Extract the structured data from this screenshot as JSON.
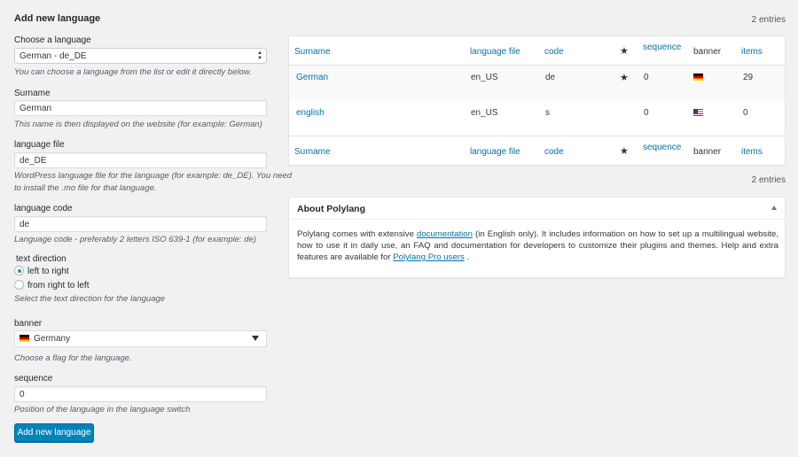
{
  "form": {
    "title": "Add new language",
    "choose_label": "Choose a language",
    "choose_value": "German - de_DE",
    "choose_desc": "You can choose a language from the list or edit it directly below.",
    "surname_label": "Surname",
    "surname_value": "German",
    "surname_desc": "This name is then displayed on the website (for example: German)",
    "langfile_label": "language file",
    "langfile_value": "de_DE",
    "langfile_desc_1": "WordPress language file for the language (for example: de_DE). You need",
    "langfile_desc_2": "to install the .mo file for that language.",
    "code_label": "language code",
    "code_value": "de",
    "code_desc": "Language code - preferably 2 letters ISO 639-1 (for example: de)",
    "direction_label": "text direction",
    "direction_ltr": "left to right",
    "direction_rtl": "from right to left",
    "direction_desc": "Select the text direction for the language",
    "banner_label": "banner",
    "banner_value": "Germany",
    "banner_desc": "Choose a flag for the language.",
    "sequence_label": "sequence",
    "sequence_value": "0",
    "sequence_desc": "Position of the language in the language switch",
    "submit_label": "Add new language"
  },
  "table": {
    "count_top": "2 entries",
    "count_bottom": "2 entries",
    "columns": {
      "surname": "Surname",
      "langfile": "language file",
      "code": "code",
      "default": "★",
      "sequence": "sequence",
      "banner": "banner",
      "items": "items"
    },
    "rows": [
      {
        "surname": "German",
        "langfile": "en_US",
        "code": "de",
        "default": "★",
        "sequence": "0",
        "flag": "germany-flag-icon",
        "items": "29"
      },
      {
        "surname": "english",
        "langfile": "en_US",
        "code": "s",
        "default": "",
        "sequence": "0",
        "flag": "usa-flag-icon",
        "items": "0"
      }
    ]
  },
  "about": {
    "title": "About Polylang",
    "text_1": "Polylang comes with extensive ",
    "link_1": "documentation",
    "text_2": " (in English only). It includes information on how to set up a multilingual website, how to use it in daily use, an FAQ and documentation for developers to customize their plugins and themes. Help and extra features are available for ",
    "link_2": "Polylang Pro users",
    "text_3": " ."
  }
}
